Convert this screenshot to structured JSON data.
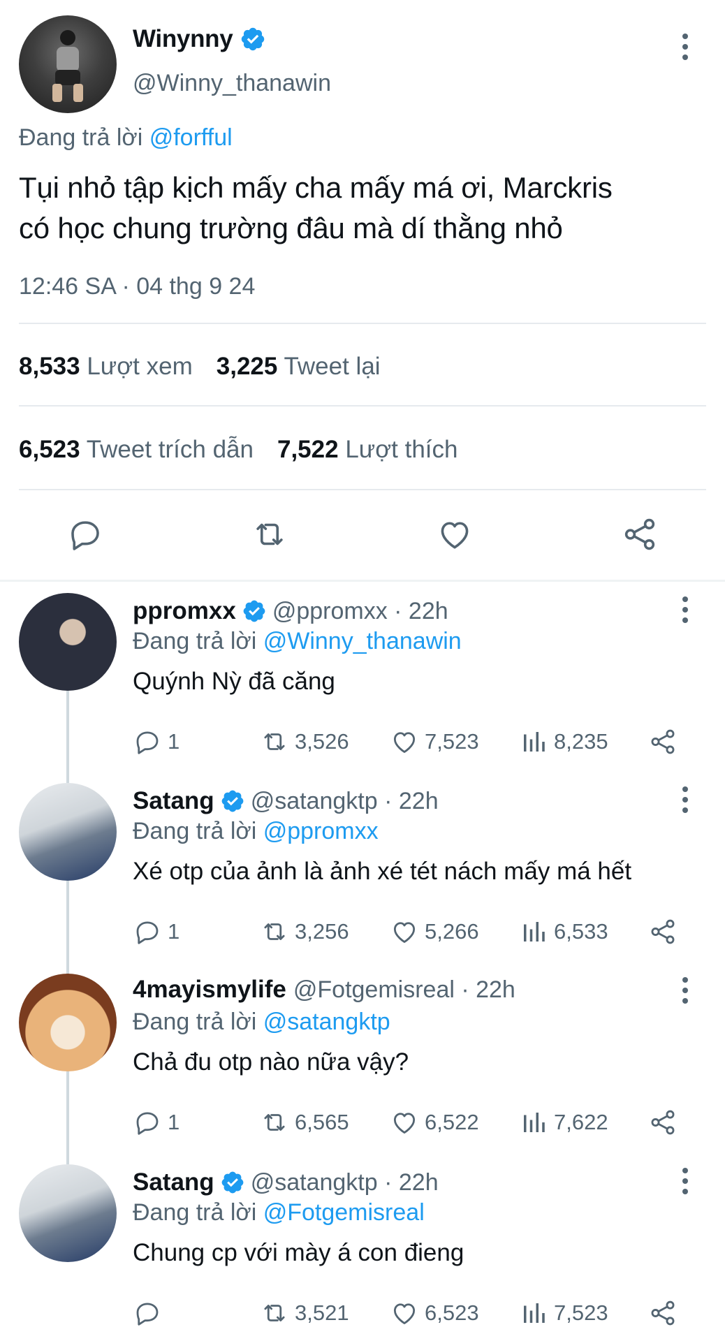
{
  "main_tweet": {
    "display_name": "Winynny",
    "handle": "@Winny_thanawin",
    "reply_prefix": "Đang trả lời",
    "reply_to": "@forfful",
    "text_line1": "Tụi nhỏ tập kịch mấy cha mấy má ơi, Marckris",
    "text_line2": "có học chung trường đâu mà dí thằng nhỏ",
    "timestamp": "12:46 SA · 04 thg 9 24",
    "views_count": "8,533",
    "views_label": "Lượt xem",
    "retweets_count": "3,225",
    "retweets_label": "Tweet lại",
    "quotes_count": "6,523",
    "quotes_label": "Tweet trích dẫn",
    "likes_count": "7,522",
    "likes_label": "Lượt thích"
  },
  "replies": [
    {
      "display_name": "ppromxx",
      "handle_time": "@ppromxx · 22h",
      "reply_prefix": "Đang trả lời",
      "reply_to": "@Winny_thanawin",
      "text": "Quýnh Nỳ đã căng",
      "replies": "1",
      "retweets": "3,526",
      "likes": "7,523",
      "views": "8,235"
    },
    {
      "display_name": "Satang",
      "handle_time": "@satangktp · 22h",
      "reply_prefix": "Đang trả lời",
      "reply_to": "@ppromxx",
      "text": "Xé otp của ảnh là ảnh xé tét nách mấy má hết",
      "replies": "1",
      "retweets": "3,256",
      "likes": "5,266",
      "views": "6,533"
    },
    {
      "display_name": "4mayismylife",
      "handle_time": "@Fotgemisreal · 22h",
      "reply_prefix": "Đang trả lời",
      "reply_to": "@satangktp",
      "text": "Chả đu otp nào nữa vậy?",
      "replies": "1",
      "retweets": "6,565",
      "likes": "6,522",
      "views": "7,622"
    },
    {
      "display_name": "Satang",
      "handle_time": "@satangktp · 22h",
      "reply_prefix": "Đang trả lời",
      "reply_to": "@Fotgemisreal",
      "text": "Chung cp với mày á con đieng",
      "replies": "",
      "retweets": "3,521",
      "likes": "6,523",
      "views": "7,523"
    }
  ],
  "colors": {
    "accent": "#1d9bf0",
    "text_primary": "#0f1419",
    "text_secondary": "#536471",
    "divider": "#e6eaee"
  },
  "icons": {
    "verified": "verified-badge-icon",
    "more": "more-vertical-icon",
    "reply": "reply-bubble-icon",
    "retweet": "retweet-icon",
    "like": "heart-icon",
    "views": "views-bar-chart-icon",
    "share": "share-icon"
  }
}
